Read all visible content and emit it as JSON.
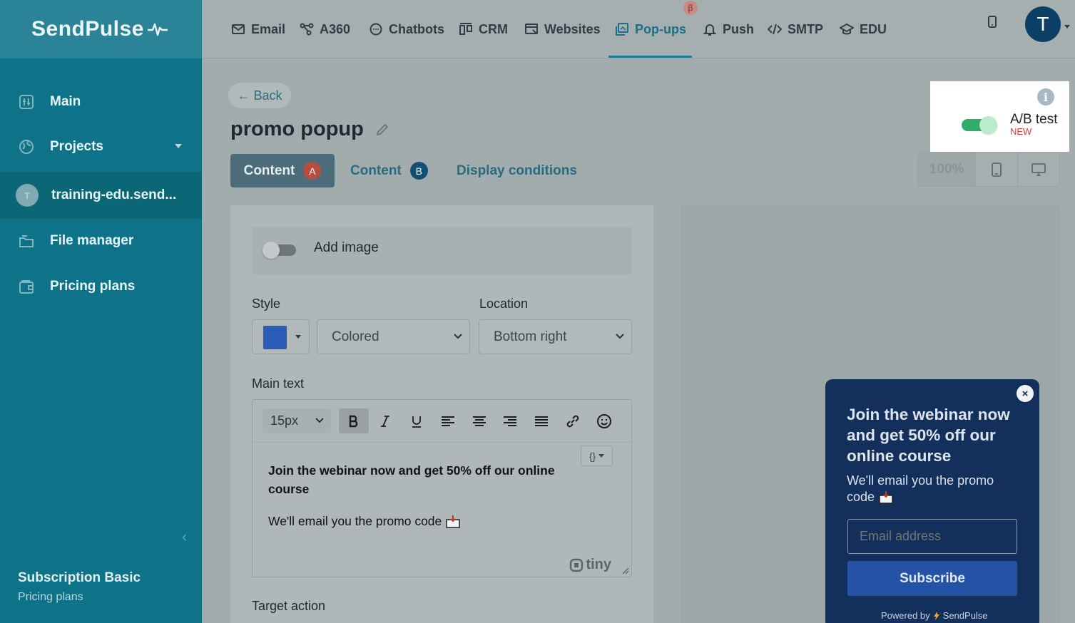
{
  "sidebar": {
    "logo": "SendPulse",
    "items": [
      {
        "label": "Main",
        "icon": "dashboard-icon"
      },
      {
        "label": "Projects",
        "icon": "globe-icon"
      },
      {
        "label": "training-edu.send...",
        "icon": "avatar",
        "avatar_letter": "T"
      },
      {
        "label": "File manager",
        "icon": "folder-icon"
      },
      {
        "label": "Pricing plans",
        "icon": "wallet-icon"
      }
    ],
    "subscription_title": "Subscription Basic",
    "subscription_link": "Pricing plans"
  },
  "topnav": {
    "items": [
      {
        "label": "Email",
        "icon": "envelope-icon"
      },
      {
        "label": "A360",
        "icon": "automation-icon"
      },
      {
        "label": "Chatbots",
        "icon": "chat-icon"
      },
      {
        "label": "CRM",
        "icon": "crm-icon"
      },
      {
        "label": "Websites",
        "icon": "website-icon"
      },
      {
        "label": "Pop-ups",
        "icon": "popup-icon",
        "active": true
      },
      {
        "label": "Push",
        "icon": "bell-icon"
      },
      {
        "label": "SMTP",
        "icon": "code-icon"
      },
      {
        "label": "EDU",
        "icon": "graduation-cap-icon"
      }
    ],
    "beta_badge": "β",
    "user_initial": "T"
  },
  "page": {
    "back_label": "← Back",
    "title": "promo popup",
    "tabs": [
      {
        "label": "Content",
        "badge": "A",
        "active": true
      },
      {
        "label": "Content",
        "badge": "B"
      },
      {
        "label": "Display conditions"
      }
    ]
  },
  "ab_test": {
    "label": "A/B test",
    "new_tag": "NEW",
    "enabled": true,
    "info_glyph": "i"
  },
  "zoom": {
    "level": "100%"
  },
  "editor_panel": {
    "add_image_label": "Add image",
    "add_image_enabled": false,
    "style_label": "Style",
    "style_color": "#2a5bb7",
    "style_value": "Colored",
    "location_label": "Location",
    "location_value": "Bottom right",
    "main_text_label": "Main text",
    "font_size": "15px",
    "variable_button": "{}",
    "text_bold": "Join the webinar now and get 50% off our online course",
    "text_body": "We'll email you the promo code",
    "tiny_brand": "tiny",
    "target_action_label": "Target action"
  },
  "popup_preview": {
    "title": "Join the webinar now and get 50% off our online course",
    "description": "We'll email you the promo code",
    "email_placeholder": "Email address",
    "subscribe_label": "Subscribe",
    "powered_by": "Powered by",
    "powered_brand": "SendPulse",
    "close_glyph": "×"
  },
  "colors": {
    "sidebar": "#0e7388",
    "accent": "#1b7d93",
    "popup_bg": "#132f5b",
    "subscribe_btn": "#2453a6",
    "toggle_on": "#2fae6a"
  }
}
